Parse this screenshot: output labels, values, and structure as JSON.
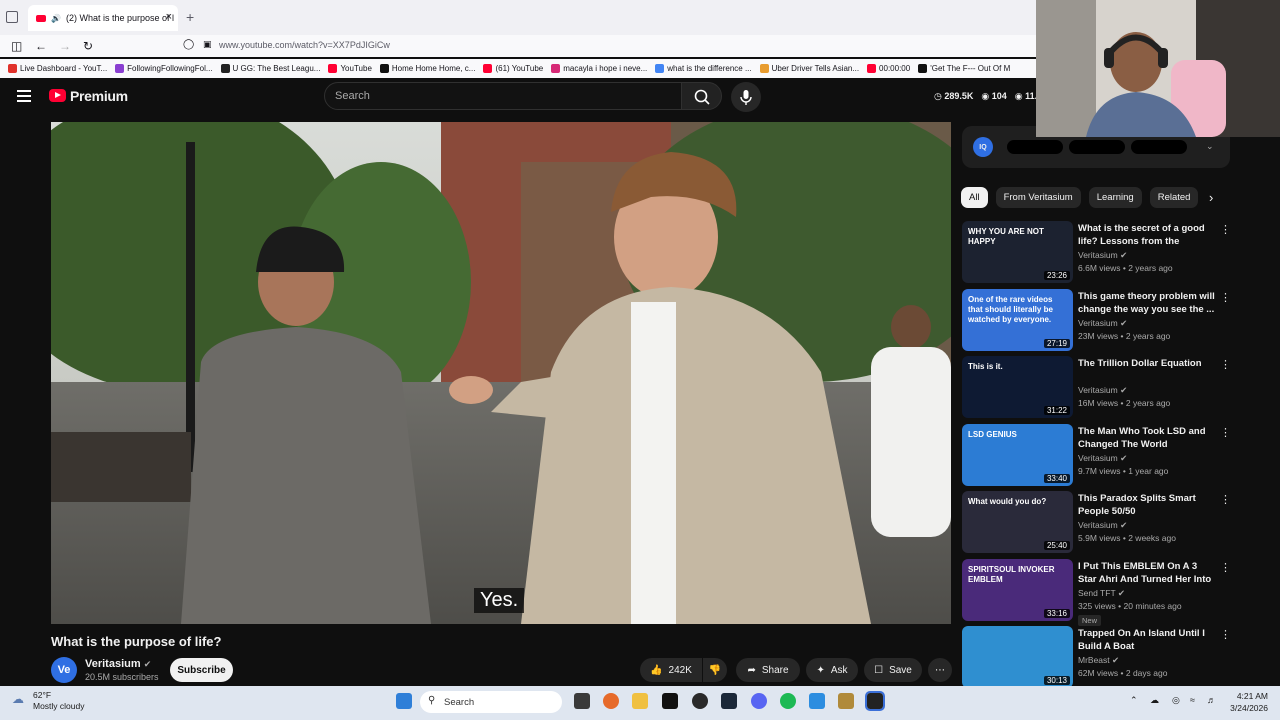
{
  "browser": {
    "tab_title": "(2) What is the purpose of l",
    "url": "www.youtube.com/watch?v=XX7PdJIGiCw",
    "bookmarks": [
      {
        "label": "Live Dashboard - YouT...",
        "color": "#e0312b"
      },
      {
        "label": "FollowingFollowingFol...",
        "color": "#8a3fd1"
      },
      {
        "label": "U GG: The Best Leagu...",
        "color": "#222222"
      },
      {
        "label": "YouTube",
        "color": "#ff0033"
      },
      {
        "label": "Home Home Home, c...",
        "color": "#111111"
      },
      {
        "label": "(61) YouTube",
        "color": "#ff0033"
      },
      {
        "label": "macayla i hope i neve...",
        "color": "#d62976"
      },
      {
        "label": "what is the difference ...",
        "color": "#4285f4"
      },
      {
        "label": "Uber Driver Tells Asian...",
        "color": "#e89c2f"
      },
      {
        "label": "00:00:00",
        "color": "#ff0033"
      },
      {
        "label": "'Get The F--- Out Of M",
        "color": "#111111"
      }
    ]
  },
  "yt": {
    "brand": "Premium",
    "search_placeholder": "Search",
    "stats": [
      "289.5K",
      "104",
      "11.9"
    ]
  },
  "video": {
    "subtitle": "Yes.",
    "title": "What is the purpose of life?",
    "channel": "Veritasium",
    "channel_initials": "Ve",
    "subscribers": "20.5M subscribers",
    "subscribe_label": "Subscribe",
    "likes": "242K",
    "share_label": "Share",
    "ask_label": "Ask",
    "save_label": "Save"
  },
  "sidebar": {
    "ext_logo": "IQ",
    "filters": [
      "All",
      "From Veritasium",
      "Learning",
      "Related"
    ],
    "recommendations": [
      {
        "title": "What is the secret of a good life? Lessons from the longest...",
        "channel": "Veritasium",
        "meta": "6.6M views • 2 years ago",
        "duration": "23:26",
        "thumb_text": "WHY YOU ARE NOT HAPPY",
        "new": ""
      },
      {
        "title": "This game theory problem will change the way you see the ...",
        "channel": "Veritasium",
        "meta": "23M views • 2 years ago",
        "duration": "27:19",
        "thumb_text": "One of the rare videos that should literally be watched by everyone.",
        "new": ""
      },
      {
        "title": "The Trillion Dollar Equation",
        "channel": "Veritasium",
        "meta": "16M views • 2 years ago",
        "duration": "31:22",
        "thumb_text": "This is it.",
        "new": ""
      },
      {
        "title": "The Man Who Took LSD and Changed The World",
        "channel": "Veritasium",
        "meta": "9.7M views • 1 year ago",
        "duration": "33:40",
        "thumb_text": "LSD GENIUS",
        "new": ""
      },
      {
        "title": "This Paradox Splits Smart People 50/50",
        "channel": "Veritasium",
        "meta": "5.9M views • 2 weeks ago",
        "duration": "25:40",
        "thumb_text": "What would you do?",
        "new": ""
      },
      {
        "title": "I Put This EMBLEM On A 3 Star Ahri And Turned Her Into An ...",
        "channel": "Send TFT",
        "meta": "325 views • 20 minutes ago",
        "duration": "33:16",
        "thumb_text": "SPIRITSOUL INVOKER EMBLEM",
        "new": "New"
      },
      {
        "title": "Trapped On An Island Until I Build A Boat",
        "channel": "MrBeast",
        "meta": "62M views • 2 days ago",
        "duration": "30:13",
        "thumb_text": "",
        "new": ""
      }
    ]
  },
  "taskbar": {
    "temp": "62°F",
    "condition": "Mostly cloudy",
    "search_label": "Search",
    "time": "4:21 AM",
    "date": "3/24/2026"
  }
}
